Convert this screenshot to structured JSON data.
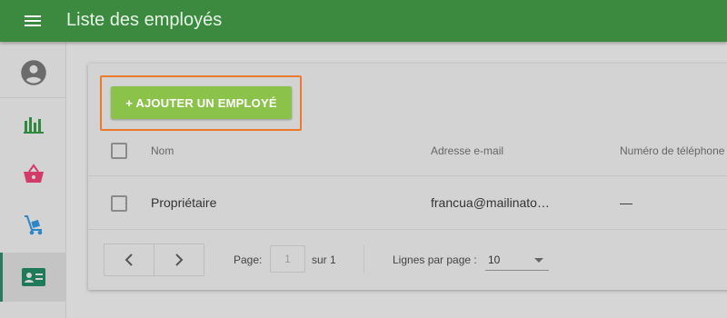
{
  "header": {
    "title": "Liste des employés"
  },
  "sidebar": {
    "items": [
      {
        "name": "user",
        "icon": "account-circle-icon"
      },
      {
        "name": "reports",
        "icon": "bar-chart-icon",
        "color": "#2f8a3f"
      },
      {
        "name": "sales",
        "icon": "basket-icon",
        "color": "#d23c6b"
      },
      {
        "name": "inventory",
        "icon": "hand-truck-icon",
        "color": "#2f86c6"
      },
      {
        "name": "employees",
        "icon": "employee-card-icon",
        "color": "#1f7a5a",
        "active": true
      }
    ]
  },
  "toolbar": {
    "add_label": "+ AJOUTER UN EMPLOYÉ"
  },
  "table": {
    "columns": [
      "Nom",
      "Adresse e-mail",
      "Numéro de téléphone"
    ],
    "rows": [
      {
        "name": "Propriétaire",
        "email": "francua@mailinato…",
        "phone": "—"
      }
    ]
  },
  "pagination": {
    "page_label": "Page:",
    "page_value": "1",
    "of_label": "sur 1",
    "rows_label": "Lignes par page :",
    "rows_value": "10"
  },
  "colors": {
    "appbar": "#3b8a3f",
    "add_button": "#8bc34a",
    "highlight": "#ec7a2d"
  }
}
